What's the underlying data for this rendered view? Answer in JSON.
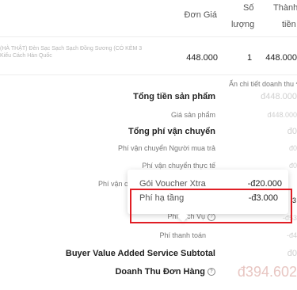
{
  "table": {
    "col_unit_price": "Đơn Giá",
    "col_quantity_line1": "Số",
    "col_quantity_line2": "lượng",
    "col_total_line1": "Thành",
    "col_total_line2": "tiền"
  },
  "product": {
    "name_line1": "(HÀ THẬT) Đèn Sạc Sạch Sạch Đồng Sương (CÓ KÈM 3",
    "name_line2": "Kiểu Cách Hàn Quốc",
    "unit_price": "448.000",
    "quantity": "1",
    "total": "448.000"
  },
  "summary": {
    "toggle_details": "Ẩn chi tiết doanh thu",
    "toggle_arrow": "^",
    "subtotal_label": "Tổng tiền sản phẩm",
    "subtotal_value": "đ448.000",
    "product_price_label": "Giá sản phẩm",
    "product_price_value": "đ448.000",
    "shipping_total_label": "Tổng phí vận chuyển",
    "shipping_total_value": "đ0",
    "buyer_shipping_label": "Phí vận chuyển Người mua trả",
    "buyer_shipping_value": "đ0",
    "actual_shipping_label": "Phí vận chuyển thực tế",
    "actual_shipping_value": "đ0",
    "shipping_partial_label": "Phí vận chu",
    "service_fee_label": "Phí Dịch Vụ",
    "service_fee_value": "-đ53",
    "payment_fee_label": "Phí thanh toán",
    "payment_fee_value": "-đ4",
    "buyer_vas_label": "Buyer Value Added Service Subtotal",
    "buyer_vas_value": "đ0",
    "order_revenue_label": "Doanh Thu Đơn Hàng",
    "order_revenue_value": "đ394.602",
    "partial_value_right": "3"
  },
  "popover": {
    "row1_label": "Gói Voucher Xtra",
    "row1_value": "-đ20.000",
    "row2_label": "Phí hạ tầng",
    "row2_value": "-đ3.000"
  },
  "colors": {
    "highlight_border": "#e01e25",
    "muted_value": "#d0d0d0"
  }
}
